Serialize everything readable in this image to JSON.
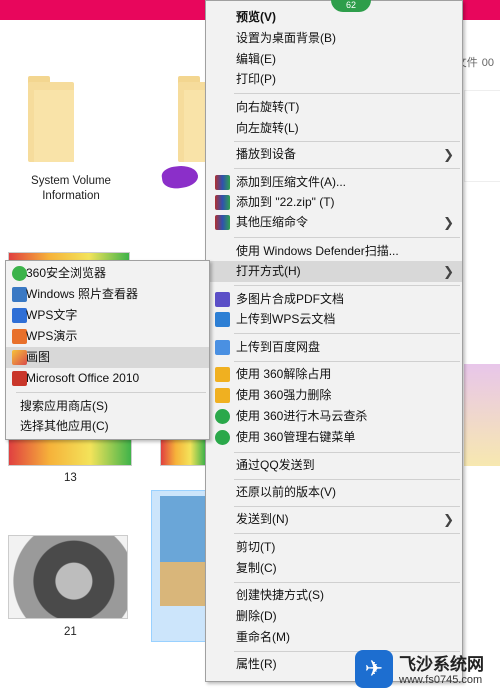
{
  "window": {
    "titlebar_color": "#e8065c",
    "search_placeholder": "\"文件",
    "search_placeholder_tail": "00"
  },
  "files": {
    "folder1_label": "System Volume Information",
    "thumb_labels": [
      "13",
      "21"
    ]
  },
  "context_menu": {
    "badge": "62",
    "items": [
      {
        "label": "预览(V)",
        "bold": true
      },
      {
        "label": "设置为桌面背景(B)"
      },
      {
        "label": "编辑(E)"
      },
      {
        "label": "打印(P)"
      },
      {
        "label": "向右旋转(T)"
      },
      {
        "label": "向左旋转(L)"
      },
      {
        "label": "播放到设备"
      },
      {
        "label": "添加到压缩文件(A)..."
      },
      {
        "label": "添加到 \"22.zip\" (T)"
      },
      {
        "label": "其他压缩命令"
      },
      {
        "label": "使用 Windows Defender扫描..."
      },
      {
        "label": "打开方式(H)"
      },
      {
        "label": "多图片合成PDF文档"
      },
      {
        "label": "上传到WPS云文档"
      },
      {
        "label": "上传到百度网盘"
      },
      {
        "label": "使用 360解除占用"
      },
      {
        "label": "使用 360强力删除"
      },
      {
        "label": "使用 360进行木马云查杀"
      },
      {
        "label": "使用 360管理右键菜单"
      },
      {
        "label": "通过QQ发送到"
      },
      {
        "label": "还原以前的版本(V)"
      },
      {
        "label": "发送到(N)"
      },
      {
        "label": "剪切(T)"
      },
      {
        "label": "复制(C)"
      },
      {
        "label": "创建快捷方式(S)"
      },
      {
        "label": "删除(D)"
      },
      {
        "label": "重命名(M)"
      },
      {
        "label": "属性(R)"
      }
    ]
  },
  "open_with_menu": {
    "items": [
      {
        "label": "360安全浏览器"
      },
      {
        "label": "Windows 照片查看器"
      },
      {
        "label": "WPS文字"
      },
      {
        "label": "WPS演示"
      },
      {
        "label": "画图"
      },
      {
        "label": "Microsoft Office 2010"
      },
      {
        "label": "搜索应用商店(S)"
      },
      {
        "label": "选择其他应用(C)"
      }
    ]
  },
  "watermark": {
    "title": "飞沙系统网",
    "url": "www.fs0745.com"
  }
}
